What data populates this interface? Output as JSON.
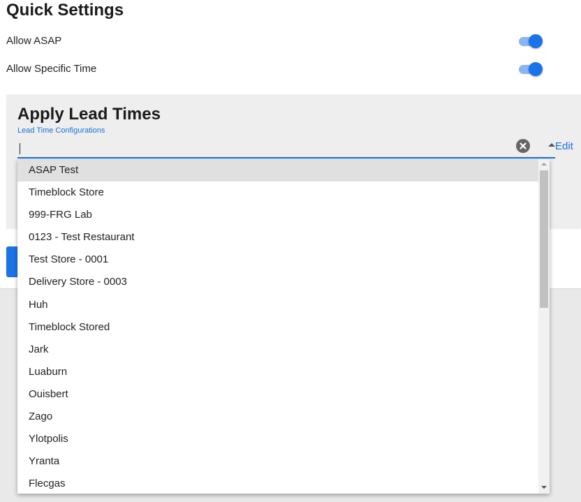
{
  "quick_settings": {
    "title": "Quick Settings",
    "settings": [
      {
        "label": "Allow ASAP",
        "enabled": true
      },
      {
        "label": "Allow Specific Time",
        "enabled": true
      }
    ]
  },
  "lead_times": {
    "title": "Apply Lead Times",
    "field_label": "Lead Time Configurations",
    "input_value": "",
    "edit_label": "Edit",
    "icons": {
      "clear": "clear-circle-icon",
      "toggle_dropdown": "caret-up-icon"
    }
  },
  "dropdown": {
    "highlighted_index": 0,
    "options": [
      "ASAP Test",
      "Timeblock Store",
      "999-FRG Lab",
      "0123 - Test Restaurant",
      "Test Store - 0001",
      "Delivery Store - 0003",
      "Huh",
      "Timeblock Stored",
      "Jark",
      "Luaburn",
      "Ouisbert",
      "Zago",
      "Ylotpolis",
      "Yranta",
      "Flecgas"
    ]
  },
  "colors": {
    "accent": "#1a73e8",
    "toggle_track": "#8ab4f2",
    "card_background": "#eeeeee",
    "highlight": "#e0e0e0"
  }
}
